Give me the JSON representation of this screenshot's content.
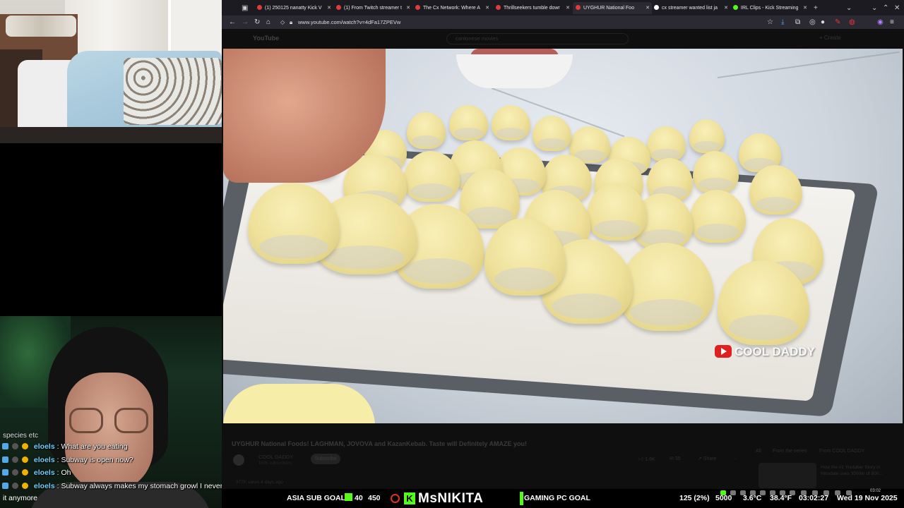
{
  "browser": {
    "tabs": [
      {
        "label": "(1) 250125 nanatty Kick V",
        "color": "#e03c3c"
      },
      {
        "label": "(1) From Twitch streamer t",
        "color": "#e03c3c"
      },
      {
        "label": "The Cx Network: Where A",
        "color": "#e03c3c"
      },
      {
        "label": "Thrillseekers tumble dowr",
        "color": "#e03c3c"
      },
      {
        "label": "UYGHUR National Foo",
        "color": "#e03c3c"
      },
      {
        "label": "cx streamer wanted list ja",
        "color": "#ffffff"
      },
      {
        "label": "IRL Clips - Kick Streaming",
        "color": "#53fc18"
      }
    ],
    "new_tab": "+",
    "url": "www.youtube.com/watch?v=4dFa17ZPEVw"
  },
  "youtube": {
    "logo": "YouTube",
    "search_value": "cantonese movies",
    "create_label": "+ Create",
    "watermark": "COOL DADDY",
    "video_title": "UYGHUR National Foods! LAGHMAN, JOVOVA and KazanKebab. Taste will Definitely AMAZE you!",
    "channel_name": "COOL DADDY",
    "subscribers": "163K subscribers",
    "subscribe_label": "Subscribe",
    "likes": "1.6K",
    "comments": "35",
    "share_label": "Share",
    "more_label": "...",
    "meta": "377K views  4 days ago",
    "chips": [
      "All",
      "From the series",
      "From COOL DADDY"
    ],
    "rec_title": "How the #1 Youtuber Story in Hinsdale uses 3500m of 800..."
  },
  "chat": {
    "cut_line": "species etc",
    "messages": [
      {
        "user": "eloels",
        "text": "What are you eating"
      },
      {
        "user": "eloels",
        "text": "Subway is open now?"
      },
      {
        "user": "eloels",
        "text": "Oh"
      },
      {
        "user": "eloels",
        "text": "Subway always makes my stomach growl I never eat"
      }
    ],
    "wrap_line": "it anymore"
  },
  "stream_bar": {
    "sub_goal_label": "ASIA SUB GOAL",
    "sub_goal_current": "40",
    "sub_goal_target": "450",
    "streamer_name": "MsNIKITA",
    "k_logo": "K",
    "gaming_goal_label": "GAMING PC GOAL",
    "gaming_goal_fill_fraction": 0.02,
    "gaming_goal_progress": "125 (2%)",
    "gaming_goal_target": "5000",
    "temp_c": "3.6°C",
    "temp_f": "38.4°F",
    "time": "03:02:27",
    "date": "Wed 19 Nov 2025",
    "sys_clock": "03:02"
  }
}
